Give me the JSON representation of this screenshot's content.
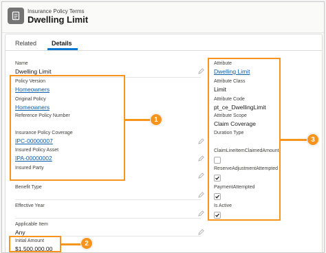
{
  "header": {
    "object_label": "Insurance Policy Terms",
    "record_title": "Dwelling Limit",
    "icon": "document-icon"
  },
  "tabs": [
    {
      "label": "Related",
      "active": false
    },
    {
      "label": "Details",
      "active": true
    }
  ],
  "left_fields": [
    {
      "label": "Name",
      "value": "Dwelling Limit",
      "link": false
    },
    {
      "label": "Policy Version",
      "value": "Homeowners",
      "link": true
    },
    {
      "label": "Original Policy",
      "value": "Homeowners",
      "link": true
    },
    {
      "label": "Reference Policy Number",
      "value": "",
      "link": false
    },
    {
      "label": "Insurance Policy Coverage",
      "value": "IPC-00000007",
      "link": true
    },
    {
      "label": "Insured Policy Asset",
      "value": "IPA-00000002",
      "link": true
    },
    {
      "label": "Insured Party",
      "value": "",
      "link": false
    },
    {
      "label": "Benefit Type",
      "value": "",
      "link": false
    },
    {
      "label": "Effective Year",
      "value": "",
      "link": false
    },
    {
      "label": "Applicable Item",
      "value": "Any",
      "link": false
    },
    {
      "label": "Initial Amount",
      "value": "$1,500,000.00",
      "link": false
    }
  ],
  "right_fields": [
    {
      "label": "Attribute",
      "value": "Dwelling Limit",
      "link": true
    },
    {
      "label": "Attribute Class",
      "value": "Limit",
      "link": false
    },
    {
      "label": "Attribute Code",
      "value": "pt_ce_DwellingLimit",
      "link": false
    },
    {
      "label": "Attribute Scope",
      "value": "Claim Coverage",
      "link": false
    },
    {
      "label": "Duration Type",
      "value": "",
      "link": false
    }
  ],
  "right_checkboxes": [
    {
      "label": "ClaimLineItemClaimedAmount",
      "checked": false
    },
    {
      "label": "ReserveAdjustmentAttempted",
      "checked": true
    },
    {
      "label": "PaymentAttempted",
      "checked": true
    },
    {
      "label": "Is Active",
      "checked": true
    }
  ],
  "callouts": [
    {
      "number": "1"
    },
    {
      "number": "2"
    },
    {
      "number": "3"
    }
  ],
  "colors": {
    "accent": "#0176d3",
    "link": "#0b5cab",
    "callout": "#f7941d"
  }
}
